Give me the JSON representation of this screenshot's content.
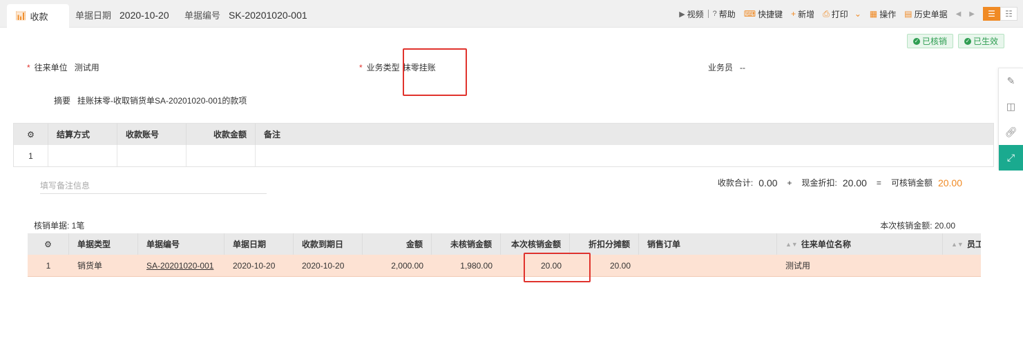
{
  "header": {
    "tab_icon": "chart-icon",
    "tab_label": "收款",
    "date_label": "单据日期",
    "date_value": "2020-10-20",
    "no_label": "单据编号",
    "no_value": "SK-20201020-001"
  },
  "toolbar": {
    "video": "视频",
    "help": "帮助",
    "shortcut": "快捷键",
    "new": "新增",
    "print": "打印",
    "operate": "操作",
    "history": "历史单据"
  },
  "badges": {
    "verified": "已核销",
    "effective": "已生效"
  },
  "form": {
    "partner_label": "往来单位",
    "partner_value": "测试用",
    "biz_type_label": "业务类型",
    "biz_type_value": "抹零挂账",
    "salesman_label": "业务员",
    "salesman_value": "--",
    "summary_label": "摘要",
    "summary_value": "挂账抹零-收取销货单SA-20201020-001的款项"
  },
  "settle_table": {
    "columns": [
      "结算方式",
      "收款账号",
      "收款金额",
      "备注"
    ],
    "rows": [
      {
        "index": "1"
      }
    ]
  },
  "memo": {
    "placeholder": "填写备注信息"
  },
  "totals": {
    "collect_label": "收款合计:",
    "collect_value": "0.00",
    "plus": "+",
    "discount_label": "现金折扣:",
    "discount_value": "20.00",
    "eq": "=",
    "writeoff_label": "可核销金额",
    "writeoff_value": "20.00",
    "accent": "#f08a24"
  },
  "writeoff": {
    "count_label": "核销单据: 1笔",
    "current_total": "本次核销金额: 20.00",
    "columns": [
      "单据类型",
      "单据编号",
      "单据日期",
      "收款到期日",
      "金额",
      "未核销金额",
      "本次核销金额",
      "折扣分摊额",
      "销售订单",
      "往来单位名称",
      "员工名"
    ],
    "row": {
      "index": "1",
      "type": "销货单",
      "no": "SA-20201020-001",
      "date": "2020-10-20",
      "due": "2020-10-20",
      "amount": "2,000.00",
      "unverified": "1,980.00",
      "this_writeoff": "20.00",
      "discount_share": "20.00",
      "sales_order": "",
      "partner": "测试用",
      "employee": ""
    }
  }
}
